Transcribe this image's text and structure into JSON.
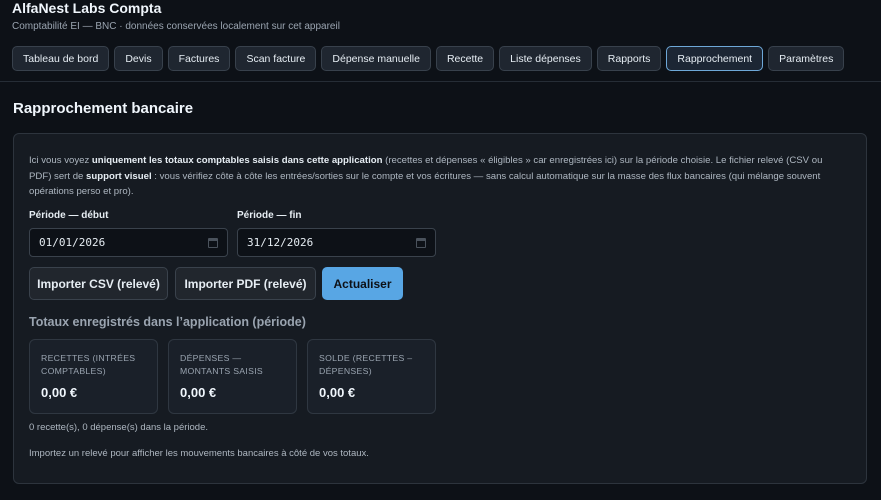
{
  "app": {
    "title": "AlfaNest Labs Compta",
    "subtitle": "Comptabilité EI — BNC · données conservées localement sur cet appareil"
  },
  "nav": {
    "tabs": [
      {
        "label": "Tableau de bord"
      },
      {
        "label": "Devis"
      },
      {
        "label": "Factures"
      },
      {
        "label": "Scan facture"
      },
      {
        "label": "Dépense manuelle"
      },
      {
        "label": "Recette"
      },
      {
        "label": "Liste dépenses"
      },
      {
        "label": "Rapports"
      },
      {
        "label": "Rapprochement",
        "active": true
      },
      {
        "label": "Paramètres"
      }
    ]
  },
  "page": {
    "title": "Rapprochement bancaire",
    "intro": {
      "p1": "Ici vous voyez ",
      "b1": "uniquement les totaux comptables saisis dans cette application",
      "p2": " (recettes et dépenses « éligibles » car enregistrées ici) sur la période choisie. Le fichier relevé (CSV ou PDF) sert de ",
      "b2": "support visuel",
      "p3": " : vous vérifiez côte à côte les entrées/sorties sur le compte et vos écritures — sans calcul automatique sur la masse des flux bancaires (qui mélange souvent opérations perso et pro)."
    },
    "period": {
      "start_label": "Période — début",
      "start_value": "01/01/2026",
      "end_label": "Période — fin",
      "end_value": "31/12/2026"
    },
    "buttons": {
      "import_csv": "Importer CSV (relevé)",
      "import_pdf": "Importer PDF (relevé)",
      "refresh": "Actualiser"
    },
    "totals": {
      "title": "Totaux enregistrés dans l’application (période)",
      "cards": [
        {
          "label": "RECETTES (INTRÉES COMPTABLES)",
          "value": "0,00 €"
        },
        {
          "label": "DÉPENSES — MONTANTS SAISIS",
          "value": "0,00 €"
        },
        {
          "label": "SOLDE (RECETTES – DÉPENSES)",
          "value": "0,00 €"
        }
      ]
    },
    "count_text": "0 recette(s), 0 dépense(s) dans la période.",
    "hint_text": "Importez un relevé pour afficher les mouvements bancaires à côté de vos totaux."
  },
  "colors": {
    "background": "#0d1117",
    "card": "#161b22",
    "accent": "#58a6e4"
  }
}
